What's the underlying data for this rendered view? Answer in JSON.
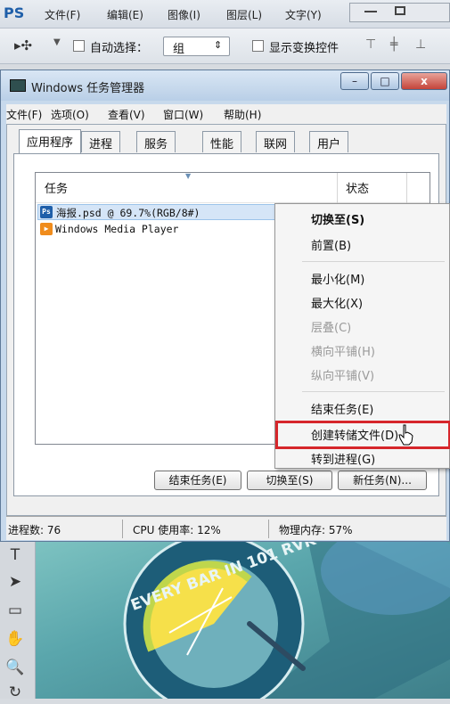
{
  "photoshop": {
    "logo": "PS",
    "menus": [
      "文件(F)",
      "编辑(E)",
      "图像(I)",
      "图层(L)",
      "文字(Y)"
    ],
    "options": {
      "auto_select_label": "自动选择：",
      "group_value": "组",
      "show_transform_label": "显示变换控件"
    },
    "canvas_text": "EVERY BAR IN 101 RVK"
  },
  "task_manager": {
    "title": "Windows 任务管理器",
    "menus": [
      "文件(F)",
      "选项(O)",
      "查看(V)",
      "窗口(W)",
      "帮助(H)"
    ],
    "tabs": [
      "应用程序",
      "进程",
      "服务",
      "性能",
      "联网",
      "用户"
    ],
    "active_tab": "应用程序",
    "columns": {
      "task": "任务",
      "status": "状态"
    },
    "tasks": [
      {
        "icon": "Ps",
        "name": "海报.psd @ 69.7%(RGB/8#)"
      },
      {
        "icon": "▶",
        "name": "Windows Media Player"
      }
    ],
    "buttons": {
      "end_task": "结束任务(E)",
      "switch_to": "切换至(S)",
      "new_task": "新任务(N)..."
    },
    "status": {
      "processes": "进程数: 76",
      "cpu": "CPU 使用率: 12%",
      "memory": "物理内存: 57%"
    }
  },
  "context_menu": {
    "items": [
      {
        "label": "切换至(S)",
        "state": "bold"
      },
      {
        "label": "前置(B)",
        "state": "normal"
      },
      {
        "label": "最小化(M)",
        "state": "normal"
      },
      {
        "label": "最大化(X)",
        "state": "normal"
      },
      {
        "label": "层叠(C)",
        "state": "disabled"
      },
      {
        "label": "横向平铺(H)",
        "state": "disabled"
      },
      {
        "label": "纵向平铺(V)",
        "state": "disabled"
      },
      {
        "label": "结束任务(E)",
        "state": "normal"
      },
      {
        "label": "创建转储文件(D)",
        "state": "highlighted"
      },
      {
        "label": "转到进程(G)",
        "state": "normal"
      }
    ]
  },
  "colors": {
    "highlight_box": "#d6262b",
    "ps_icon_bg": "#1f5fa9",
    "wmp_icon_bg": "#f08c1c",
    "close_button": "#d9534f"
  }
}
